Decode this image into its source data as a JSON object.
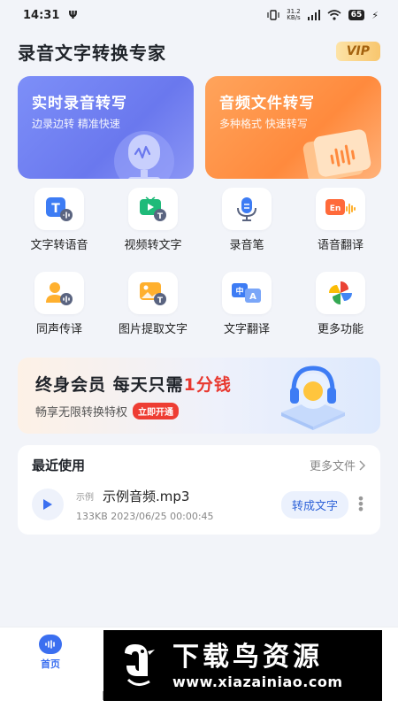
{
  "status_bar": {
    "time": "14:31",
    "net_speed_value": "31.2",
    "net_speed_unit": "KB/s",
    "battery": "65"
  },
  "header": {
    "title": "录音文字转换专家",
    "vip_label": "VIP"
  },
  "hero_cards": [
    {
      "title": "实时录音转写",
      "subtitle": "边录边转 精准快速"
    },
    {
      "title": "音频文件转写",
      "subtitle": "多种格式 快速转写"
    }
  ],
  "tools": [
    {
      "label": "文字转语音",
      "icon": "text-to-speech-icon"
    },
    {
      "label": "视频转文字",
      "icon": "video-to-text-icon"
    },
    {
      "label": "录音笔",
      "icon": "microphone-icon"
    },
    {
      "label": "语音翻译",
      "icon": "voice-translate-icon"
    },
    {
      "label": "同声传译",
      "icon": "simultaneous-interpretation-icon"
    },
    {
      "label": "图片提取文字",
      "icon": "image-to-text-icon"
    },
    {
      "label": "文字翻译",
      "icon": "text-translate-icon"
    },
    {
      "label": "更多功能",
      "icon": "more-features-icon"
    }
  ],
  "banner": {
    "title_prefix": "终身会员  每天只需",
    "title_highlight": "1分钱",
    "subtitle": "畅享无限转换特权",
    "cta": "立即开通"
  },
  "recent": {
    "title": "最近使用",
    "more_label": "更多文件",
    "file": {
      "tag": "示例",
      "name": "示例音频.mp3",
      "meta": "133KB 2023/06/25 00:00:45",
      "action_label": "转成文字"
    }
  },
  "bottom_nav": {
    "home_label": "首页"
  },
  "watermark": {
    "brand_cn": "下载鸟资源",
    "url": "www.xiazainiao.com"
  },
  "colors": {
    "primary_blue": "#3b6ff0",
    "hero_purple": "#6a78ee",
    "hero_orange": "#ff8a3d",
    "highlight_red": "#e8382f"
  }
}
